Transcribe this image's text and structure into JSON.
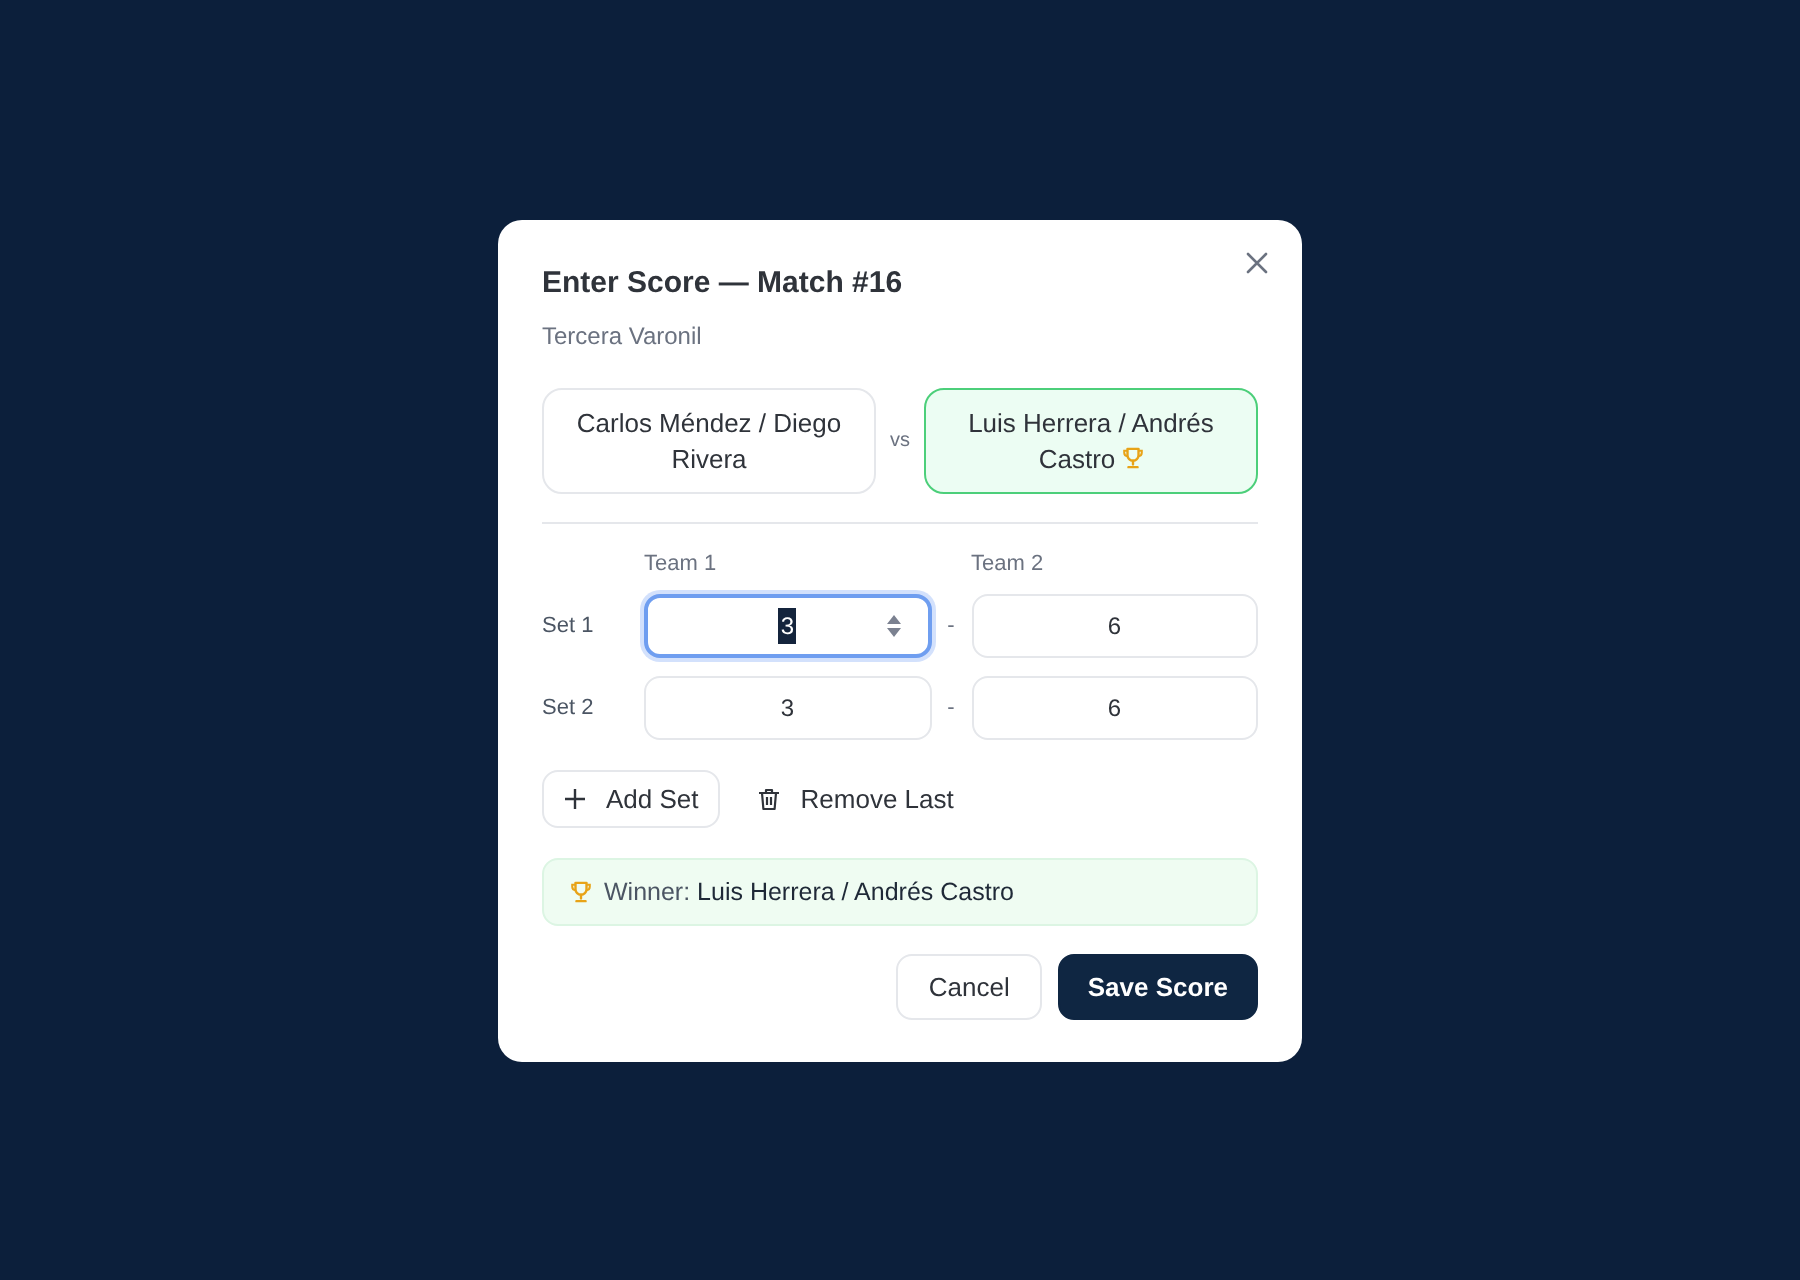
{
  "dialog": {
    "title": "Enter Score — Match #16",
    "subtitle": "Tercera Varonil"
  },
  "teams": [
    {
      "name": "Carlos Méndez / Diego Rivera",
      "winner": false
    },
    {
      "name": "Luis Herrera / Andrés Castro",
      "winner": true
    }
  ],
  "versus": "vs",
  "score_columns": [
    "Team 1",
    "Team 2"
  ],
  "sets": [
    {
      "label": "Set 1",
      "separator": "-",
      "scores": [
        {
          "value": "3",
          "focused": true
        },
        {
          "value": "6",
          "focused": false
        }
      ]
    },
    {
      "label": "Set 2",
      "separator": "-",
      "scores": [
        {
          "value": "3",
          "focused": false
        },
        {
          "value": "6",
          "focused": false
        }
      ]
    }
  ],
  "set_actions": [
    {
      "kind": "add",
      "label": "Add Set"
    },
    {
      "kind": "remove",
      "label": "Remove Last"
    }
  ],
  "winner_banner": {
    "text": "Winner: **Luis Herrera / Andrés Castro**"
  },
  "footer_buttons": [
    {
      "kind": "secondary",
      "label": "Cancel"
    },
    {
      "kind": "primary",
      "label": "Save Score"
    }
  ]
}
